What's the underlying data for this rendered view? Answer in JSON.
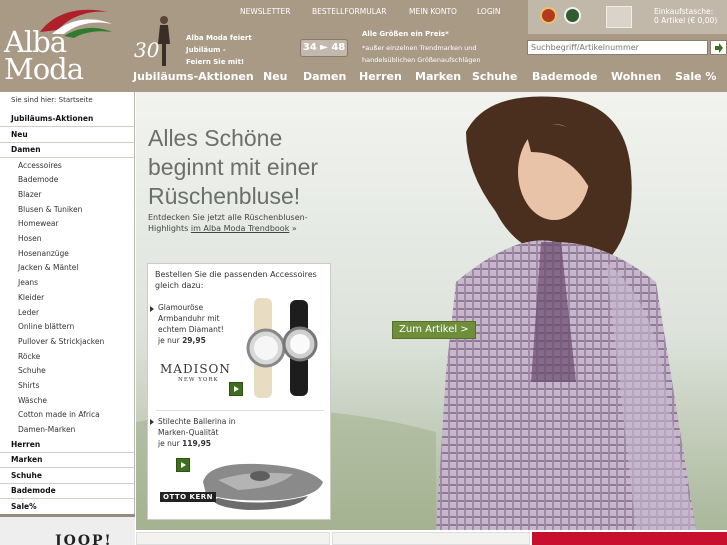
{
  "brand": {
    "logo_line1": "Alba",
    "logo_line2": "Moda"
  },
  "jubilee": {
    "number": "30",
    "text": "Alba Moda feiert Jubiläum - Feiern Sie mit!"
  },
  "sizes": {
    "badge": "34 ► 48",
    "title": "Alle Größen ein Preis*",
    "note": "*außer einzelnen Trendmarken und handelsüblichen Größenaufschlägen"
  },
  "top_nav": [
    "NEWSLETTER",
    "BESTELLFORMULAR",
    "MEIN KONTO",
    "LOGIN"
  ],
  "cart": {
    "label": "Einkaufstasche:",
    "summary": "0 Artikel (€ 0,00)"
  },
  "search": {
    "placeholder": "Suchbegriff/Artikelnummer"
  },
  "main_nav": [
    "Jubiläums-Aktionen",
    "Neu",
    "Damen",
    "Herren",
    "Marken",
    "Schuhe",
    "Bademode",
    "Wohnen",
    "Sale %"
  ],
  "breadcrumb": {
    "prefix": "Sie sind hier:",
    "current": "Startseite"
  },
  "sidebar": {
    "items": [
      {
        "label": "Jubiläums-Aktionen",
        "level": "top"
      },
      {
        "label": "Neu",
        "level": "top"
      },
      {
        "label": "Damen",
        "level": "top"
      },
      {
        "label": "Accessoires",
        "level": "sub"
      },
      {
        "label": "Bademode",
        "level": "sub"
      },
      {
        "label": "Blazer",
        "level": "sub"
      },
      {
        "label": "Blusen & Tuniken",
        "level": "sub"
      },
      {
        "label": "Homewear",
        "level": "sub"
      },
      {
        "label": "Hosen",
        "level": "sub"
      },
      {
        "label": "Hosenanzüge",
        "level": "sub"
      },
      {
        "label": "Jacken & Mäntel",
        "level": "sub"
      },
      {
        "label": "Jeans",
        "level": "sub"
      },
      {
        "label": "Kleider",
        "level": "sub"
      },
      {
        "label": "Leder",
        "level": "sub"
      },
      {
        "label": "Online blättern",
        "level": "sub"
      },
      {
        "label": "Pullover & Strickjacken",
        "level": "sub"
      },
      {
        "label": "Röcke",
        "level": "sub"
      },
      {
        "label": "Schuhe",
        "level": "sub"
      },
      {
        "label": "Shirts",
        "level": "sub"
      },
      {
        "label": "Wäsche",
        "level": "sub"
      },
      {
        "label": "Cotton made in Africa",
        "level": "sub"
      },
      {
        "label": "Damen-Marken",
        "level": "sub"
      },
      {
        "label": "Herren",
        "level": "top"
      },
      {
        "label": "Marken",
        "level": "top"
      },
      {
        "label": "Schuhe",
        "level": "top"
      },
      {
        "label": "Bademode",
        "level": "top"
      },
      {
        "label": "Sale%",
        "level": "top"
      }
    ],
    "promo_text": "JOOP!"
  },
  "hero": {
    "headline_lines": [
      "Alles Schöne",
      "beginnt mit einer",
      "Rüschenbluse!"
    ],
    "sub_text": "Entdecken Sie jetzt alle Rüschenblusen-Highlights",
    "sub_link": "im Alba Moda Trendbook",
    "sub_suffix": " »",
    "cta": "Zum Artikel >"
  },
  "accessories": {
    "title": "Bestellen Sie die passenden Accessoires gleich dazu:",
    "product1": {
      "desc": "Glamouröse Armbanduhr mit echtem Diamant!",
      "price_prefix": "je nur",
      "price": "29,95",
      "brand": "MADISON",
      "brand_sub": "NEW YORK"
    },
    "product2": {
      "desc": "Stilechte Ballerina in Marken-Qualität",
      "price_prefix": "je nur",
      "price": "119,95",
      "brand": "OTTO KERN"
    }
  },
  "colors": {
    "header_bg": "#a99a86",
    "accent_green": "#6f8e3a",
    "sale_red": "#c8102e"
  }
}
